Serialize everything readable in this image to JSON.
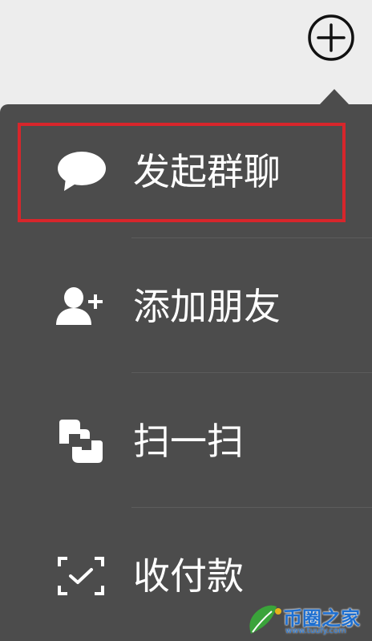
{
  "header": {
    "add_icon": "plus-circle-icon"
  },
  "menu": {
    "items": [
      {
        "label": "发起群聊",
        "icon": "chat-bubble-icon",
        "highlighted": true
      },
      {
        "label": "添加朋友",
        "icon": "add-friend-icon",
        "highlighted": false
      },
      {
        "label": "扫一扫",
        "icon": "scan-icon",
        "highlighted": false
      },
      {
        "label": "收付款",
        "icon": "payment-scan-icon",
        "highlighted": false
      }
    ]
  },
  "colors": {
    "page_background": "#ededed",
    "menu_background": "#4c4c4c",
    "menu_text": "#ffffff",
    "highlight_border": "#d7262b",
    "divider": "#5c5c5c"
  },
  "watermark": {
    "logo_icon": "leaf-logo-icon",
    "text": "币圈之家",
    "subtext": "www.tuufy.com"
  }
}
